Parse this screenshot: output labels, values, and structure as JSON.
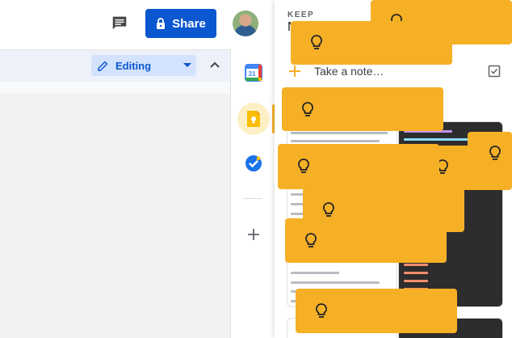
{
  "header": {
    "share_label": "Share"
  },
  "toolbar": {
    "mode_label": "Editing"
  },
  "keep": {
    "section_label": "KEEP",
    "heading_initial": "N",
    "note_placeholder": "Take a note…"
  },
  "colors": {
    "share_blue": "#0b57d0",
    "keep_yellow": "#f6b026",
    "editing_bg": "#d3e3fd"
  },
  "icons": {
    "comment": "comment-icon",
    "lock": "lock-icon",
    "pencil": "pencil-icon",
    "calendar": "calendar-icon",
    "keep": "keep-icon",
    "tasks": "tasks-icon",
    "add": "plus-icon",
    "bulb": "lightbulb-icon",
    "checkbox": "checkbox-icon"
  }
}
